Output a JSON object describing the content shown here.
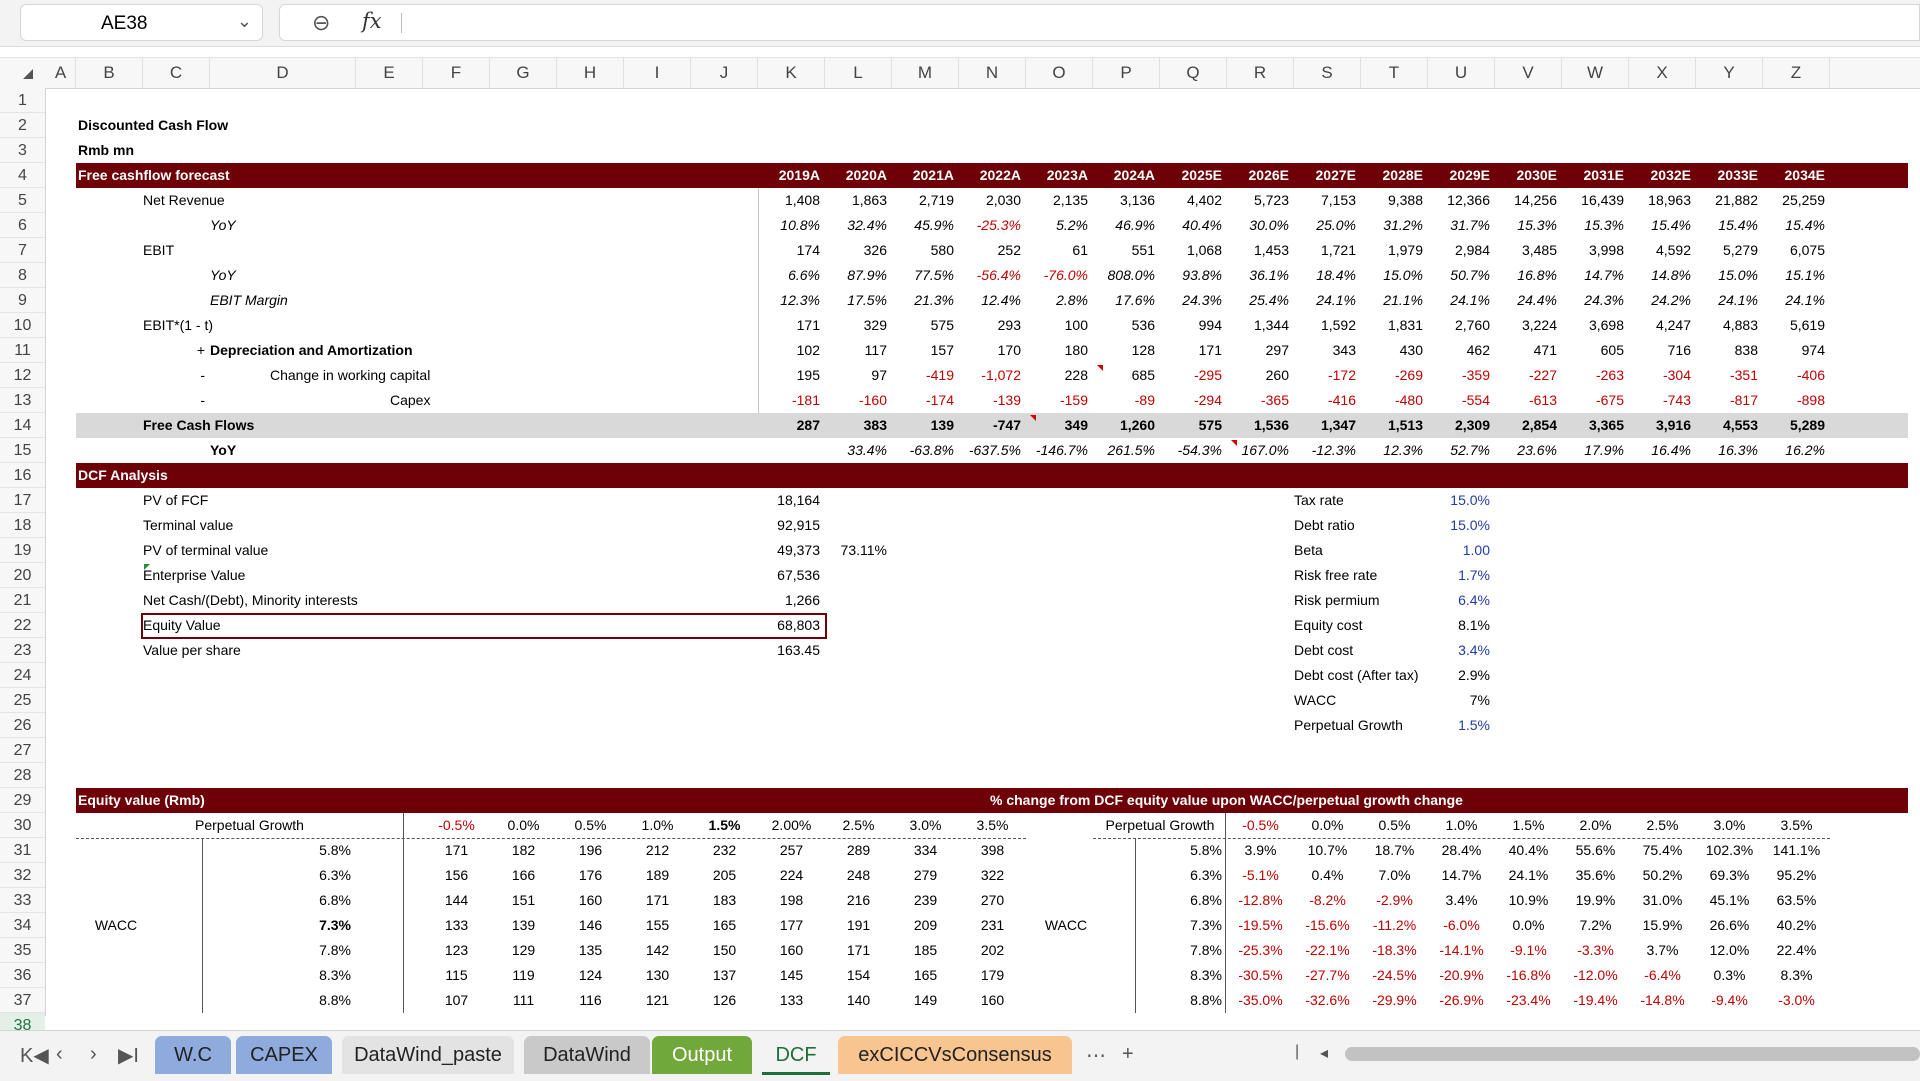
{
  "toolbar": {
    "cell_ref": "AE38",
    "zoom_icon": "zoom-out-icon",
    "fx_label": "fx"
  },
  "columns": [
    "A",
    "B",
    "C",
    "D",
    "E",
    "F",
    "G",
    "H",
    "I",
    "J",
    "K",
    "L",
    "M",
    "N",
    "O",
    "P",
    "Q",
    "R",
    "S",
    "T",
    "U",
    "V",
    "W",
    "X",
    "Y",
    "Z"
  ],
  "rows": [
    "1",
    "2",
    "3",
    "4",
    "5",
    "6",
    "7",
    "8",
    "9",
    "10",
    "11",
    "12",
    "13",
    "14",
    "15",
    "16",
    "17",
    "18",
    "19",
    "20",
    "21",
    "22",
    "23",
    "24",
    "25",
    "26",
    "27",
    "28",
    "29",
    "30",
    "31",
    "32",
    "33",
    "34",
    "35",
    "36",
    "37",
    "38"
  ],
  "selected_row": "38",
  "title": "Discounted Cash Flow",
  "unit": "Rmb mn",
  "forecast": {
    "header": "Free cashflow forecast",
    "years": [
      "2019A",
      "2020A",
      "2021A",
      "2022A",
      "2023A",
      "2024A",
      "2025E",
      "2026E",
      "2027E",
      "2028E",
      "2029E",
      "2030E",
      "2031E",
      "2032E",
      "2033E",
      "2034E"
    ],
    "rows": [
      {
        "label": "Net Revenue",
        "values": [
          "1,408",
          "1,863",
          "2,719",
          "2,030",
          "2,135",
          "3,136",
          "4,402",
          "5,723",
          "7,153",
          "9,388",
          "12,366",
          "14,256",
          "16,439",
          "18,963",
          "21,882",
          "25,259"
        ]
      },
      {
        "label": "YoY",
        "values": [
          "10.8%",
          "32.4%",
          "45.9%",
          "-25.3%",
          "5.2%",
          "46.9%",
          "40.4%",
          "30.0%",
          "25.0%",
          "31.2%",
          "31.7%",
          "15.3%",
          "15.3%",
          "15.4%",
          "15.4%",
          "15.4%"
        ]
      },
      {
        "label": "EBIT",
        "values": [
          "174",
          "326",
          "580",
          "252",
          "61",
          "551",
          "1,068",
          "1,453",
          "1,721",
          "1,979",
          "2,984",
          "3,485",
          "3,998",
          "4,592",
          "5,279",
          "6,075"
        ]
      },
      {
        "label": "YoY",
        "values": [
          "6.6%",
          "87.9%",
          "77.5%",
          "-56.4%",
          "-76.0%",
          "808.0%",
          "93.8%",
          "36.1%",
          "18.4%",
          "15.0%",
          "50.7%",
          "16.8%",
          "14.7%",
          "14.8%",
          "15.0%",
          "15.1%"
        ]
      },
      {
        "label": "EBIT Margin",
        "values": [
          "12.3%",
          "17.5%",
          "21.3%",
          "12.4%",
          "2.8%",
          "17.6%",
          "24.3%",
          "25.4%",
          "24.1%",
          "21.1%",
          "24.1%",
          "24.4%",
          "24.3%",
          "24.2%",
          "24.1%",
          "24.1%"
        ]
      },
      {
        "label": "EBIT*(1 - t)",
        "values": [
          "171",
          "329",
          "575",
          "293",
          "100",
          "536",
          "994",
          "1,344",
          "1,592",
          "1,831",
          "2,760",
          "3,224",
          "3,698",
          "4,247",
          "4,883",
          "5,619"
        ]
      },
      {
        "sign": "+",
        "label": "Depreciation and Amortization",
        "values": [
          "102",
          "117",
          "157",
          "170",
          "180",
          "128",
          "171",
          "297",
          "343",
          "430",
          "462",
          "471",
          "605",
          "716",
          "838",
          "974"
        ]
      },
      {
        "sign": "-",
        "label": "Change in working capital",
        "values": [
          "195",
          "97",
          "-419",
          "-1,072",
          "228",
          "685",
          "-295",
          "260",
          "-172",
          "-269",
          "-359",
          "-227",
          "-263",
          "-304",
          "-351",
          "-406"
        ]
      },
      {
        "sign": "-",
        "label": "Capex",
        "values": [
          "-181",
          "-160",
          "-174",
          "-139",
          "-159",
          "-89",
          "-294",
          "-365",
          "-416",
          "-480",
          "-554",
          "-613",
          "-675",
          "-743",
          "-817",
          "-898"
        ]
      },
      {
        "label": "Free Cash Flows",
        "values": [
          "287",
          "383",
          "139",
          "-747",
          "349",
          "1,260",
          "575",
          "1,536",
          "1,347",
          "1,513",
          "2,309",
          "2,854",
          "3,365",
          "3,916",
          "4,553",
          "5,289"
        ]
      },
      {
        "label": "YoY",
        "values": [
          "",
          "33.4%",
          "-63.8%",
          "-637.5%",
          "-146.7%",
          "261.5%",
          "-54.3%",
          "167.0%",
          "-12.3%",
          "12.3%",
          "52.7%",
          "23.6%",
          "17.9%",
          "16.4%",
          "16.3%",
          "16.2%"
        ]
      }
    ]
  },
  "dcf": {
    "header": "DCF Analysis",
    "items": [
      {
        "label": "PV of FCF",
        "value": "18,164",
        "extra": ""
      },
      {
        "label": "Terminal value",
        "value": "92,915",
        "extra": ""
      },
      {
        "label": "PV of terminal value",
        "value": "49,373",
        "extra": "73.11%"
      },
      {
        "label": "Enterprise Value",
        "value": "67,536",
        "extra": ""
      },
      {
        "label": "Net Cash/(Debt), Minority interests",
        "value": "1,266",
        "extra": ""
      },
      {
        "label": "Equity Value",
        "value": "68,803",
        "extra": ""
      },
      {
        "label": "Value per share",
        "value": "163.45",
        "extra": ""
      }
    ],
    "assumptions": [
      {
        "label": "Tax rate",
        "value": "15.0%",
        "input": true
      },
      {
        "label": "Debt ratio",
        "value": "15.0%",
        "input": true
      },
      {
        "label": "Beta",
        "value": "1.00",
        "input": true
      },
      {
        "label": "Risk free rate",
        "value": "1.7%",
        "input": true
      },
      {
        "label": "Risk permium",
        "value": "6.4%",
        "input": true
      },
      {
        "label": "Equity cost",
        "value": "8.1%",
        "input": false
      },
      {
        "label": "Debt cost",
        "value": "3.4%",
        "input": true
      },
      {
        "label": "Debt cost (After tax)",
        "value": "2.9%",
        "input": false
      },
      {
        "label": "WACC",
        "value": "7%",
        "input": false
      },
      {
        "label": "Perpetual Growth",
        "value": "1.5%",
        "input": true
      }
    ]
  },
  "sensitivity": {
    "left_header": "Equity value (Rmb)",
    "right_header": "% change from DCF equity value upon WACC/perpetual growth change",
    "growth_label": "Perpetual Growth",
    "wacc_label": "WACC",
    "growth_left": [
      "-0.5%",
      "0.0%",
      "0.5%",
      "1.0%",
      "1.5%",
      "2.00%",
      "2.5%",
      "3.0%",
      "3.5%"
    ],
    "growth_right": [
      "-0.5%",
      "0.0%",
      "0.5%",
      "1.0%",
      "1.5%",
      "2.0%",
      "2.5%",
      "3.0%",
      "3.5%"
    ],
    "wacc": [
      "5.8%",
      "6.3%",
      "6.8%",
      "7.3%",
      "7.8%",
      "8.3%",
      "8.8%"
    ],
    "left_values": [
      [
        "171",
        "182",
        "196",
        "212",
        "232",
        "257",
        "289",
        "334",
        "398"
      ],
      [
        "156",
        "166",
        "176",
        "189",
        "205",
        "224",
        "248",
        "279",
        "322"
      ],
      [
        "144",
        "151",
        "160",
        "171",
        "183",
        "198",
        "216",
        "239",
        "270"
      ],
      [
        "133",
        "139",
        "146",
        "155",
        "165",
        "177",
        "191",
        "209",
        "231"
      ],
      [
        "123",
        "129",
        "135",
        "142",
        "150",
        "160",
        "171",
        "185",
        "202"
      ],
      [
        "115",
        "119",
        "124",
        "130",
        "137",
        "145",
        "154",
        "165",
        "179"
      ],
      [
        "107",
        "111",
        "116",
        "121",
        "126",
        "133",
        "140",
        "149",
        "160"
      ]
    ],
    "right_values": [
      [
        "3.9%",
        "10.7%",
        "18.7%",
        "28.4%",
        "40.4%",
        "55.6%",
        "75.4%",
        "102.3%",
        "141.1%"
      ],
      [
        "-5.1%",
        "0.4%",
        "7.0%",
        "14.7%",
        "24.1%",
        "35.6%",
        "50.2%",
        "69.3%",
        "95.2%"
      ],
      [
        "-12.8%",
        "-8.2%",
        "-2.9%",
        "3.4%",
        "10.9%",
        "19.9%",
        "31.0%",
        "45.1%",
        "63.5%"
      ],
      [
        "-19.5%",
        "-15.6%",
        "-11.2%",
        "-6.0%",
        "0.0%",
        "7.2%",
        "15.9%",
        "26.6%",
        "40.2%"
      ],
      [
        "-25.3%",
        "-22.1%",
        "-18.3%",
        "-14.1%",
        "-9.1%",
        "-3.3%",
        "3.7%",
        "12.0%",
        "22.4%"
      ],
      [
        "-30.5%",
        "-27.7%",
        "-24.5%",
        "-20.9%",
        "-16.8%",
        "-12.0%",
        "-6.4%",
        "0.3%",
        "8.3%"
      ],
      [
        "-35.0%",
        "-32.6%",
        "-29.9%",
        "-26.9%",
        "-23.4%",
        "-19.4%",
        "-14.8%",
        "-9.4%",
        "-3.0%"
      ]
    ]
  },
  "sheet_tabs": [
    {
      "label": "W.C",
      "color": "#8faadc"
    },
    {
      "label": "CAPEX",
      "color": "#8faadc"
    },
    {
      "label": "DataWind_paste",
      "color": "#e3e3e3"
    },
    {
      "label": "DataWind",
      "color": "#c9c9c9"
    },
    {
      "label": "Output",
      "color": "#70a83b"
    },
    {
      "label": "DCF",
      "color": "",
      "active": true
    },
    {
      "label": "exCICCVsConsensus",
      "color": "#f8c48f"
    }
  ],
  "tab_controls": {
    "first": "K◀",
    "prev": "‹",
    "next": "›",
    "last": "▶I",
    "more": "⋯",
    "add": "+",
    "scroll_left": "◂",
    "separator": "|"
  },
  "colors": {
    "band_red": "#6e0008",
    "band_gray": "#d9d9d9",
    "negative": "#c00000",
    "input_blue": "#1f3ca3",
    "active_tab": "#1e6f38"
  }
}
